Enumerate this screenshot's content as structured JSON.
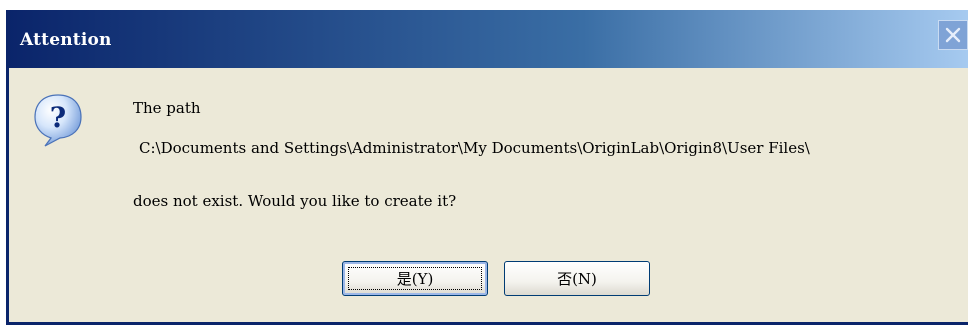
{
  "dialog": {
    "title": "Attention",
    "message_line1": "The path",
    "message_line2": "C:\\Documents and Settings\\Administrator\\My Documents\\OriginLab\\Origin8\\User Files\\",
    "message_line3": "does not exist. Would you like to create it?",
    "icon": "question-icon",
    "buttons": {
      "yes_label": "是(Y)",
      "no_label": "否(N)"
    }
  },
  "colors": {
    "title_bar": "#0a246a",
    "client_bg": "#ece9d8",
    "button_border": "#003c74"
  }
}
